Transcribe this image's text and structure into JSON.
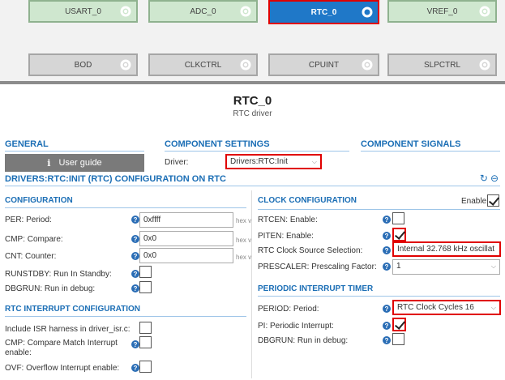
{
  "diagram": {
    "components_row1": [
      {
        "label": "USART_0"
      },
      {
        "label": "ADC_0"
      },
      {
        "label": "RTC_0"
      },
      {
        "label": "VREF_0"
      }
    ],
    "components_row2": [
      {
        "label": "BOD"
      },
      {
        "label": "CLKCTRL"
      },
      {
        "label": "CPUINT"
      },
      {
        "label": "SLPCTRL"
      }
    ]
  },
  "header": {
    "title": "RTC_0",
    "subtitle": "RTC driver"
  },
  "sections": {
    "general": "GENERAL",
    "component_settings": "COMPONENT SETTINGS",
    "component_signals": "COMPONENT SIGNALS"
  },
  "user_guide_label": "User guide",
  "driver": {
    "label": "Driver:",
    "value": "Drivers:RTC:Init"
  },
  "config_title": "DRIVERS:RTC:INIT (RTC) CONFIGURATION ON RTC",
  "configuration": {
    "heading": "CONFIGURATION",
    "per": {
      "label": "PER: Period:",
      "value": "0xffff",
      "unit": "hex v"
    },
    "cmp": {
      "label": "CMP: Compare:",
      "value": "0x0",
      "unit": "hex v"
    },
    "cnt": {
      "label": "CNT: Counter:",
      "value": "0x0",
      "unit": "hex v"
    },
    "runstdby": {
      "label": "RUNSTDBY: Run In Standby:"
    },
    "dbgrun": {
      "label": "DBGRUN: Run in debug:"
    }
  },
  "rtc_interrupt": {
    "heading": "RTC INTERRUPT CONFIGURATION",
    "isr": {
      "label": "Include ISR harness in driver_isr.c:"
    },
    "cmp": {
      "label": "CMP: Compare Match Interrupt enable:"
    },
    "ovf": {
      "label": "OVF: Overflow Interrupt enable:"
    }
  },
  "clock_configuration": {
    "heading": "CLOCK CONFIGURATION",
    "enable_label": "Enable:",
    "rtcen": {
      "label": "RTCEN: Enable:"
    },
    "piten": {
      "label": "PITEN: Enable:"
    },
    "source": {
      "label": "RTC Clock Source Selection:",
      "value": "Internal 32.768 kHz oscillat"
    },
    "prescaler": {
      "label": "PRESCALER: Prescaling Factor:",
      "value": "1"
    }
  },
  "periodic_interrupt": {
    "heading": "PERIODIC INTERRUPT TIMER",
    "period": {
      "label": "PERIOD: Period:",
      "value": "RTC Clock Cycles 16"
    },
    "pi": {
      "label": "PI: Periodic Interrupt:"
    },
    "dbgrun": {
      "label": "DBGRUN: Run in debug:"
    }
  },
  "colors": {
    "accent": "#1b6eb5",
    "highlight": "#e00000",
    "active_component": "#1f78c8"
  }
}
